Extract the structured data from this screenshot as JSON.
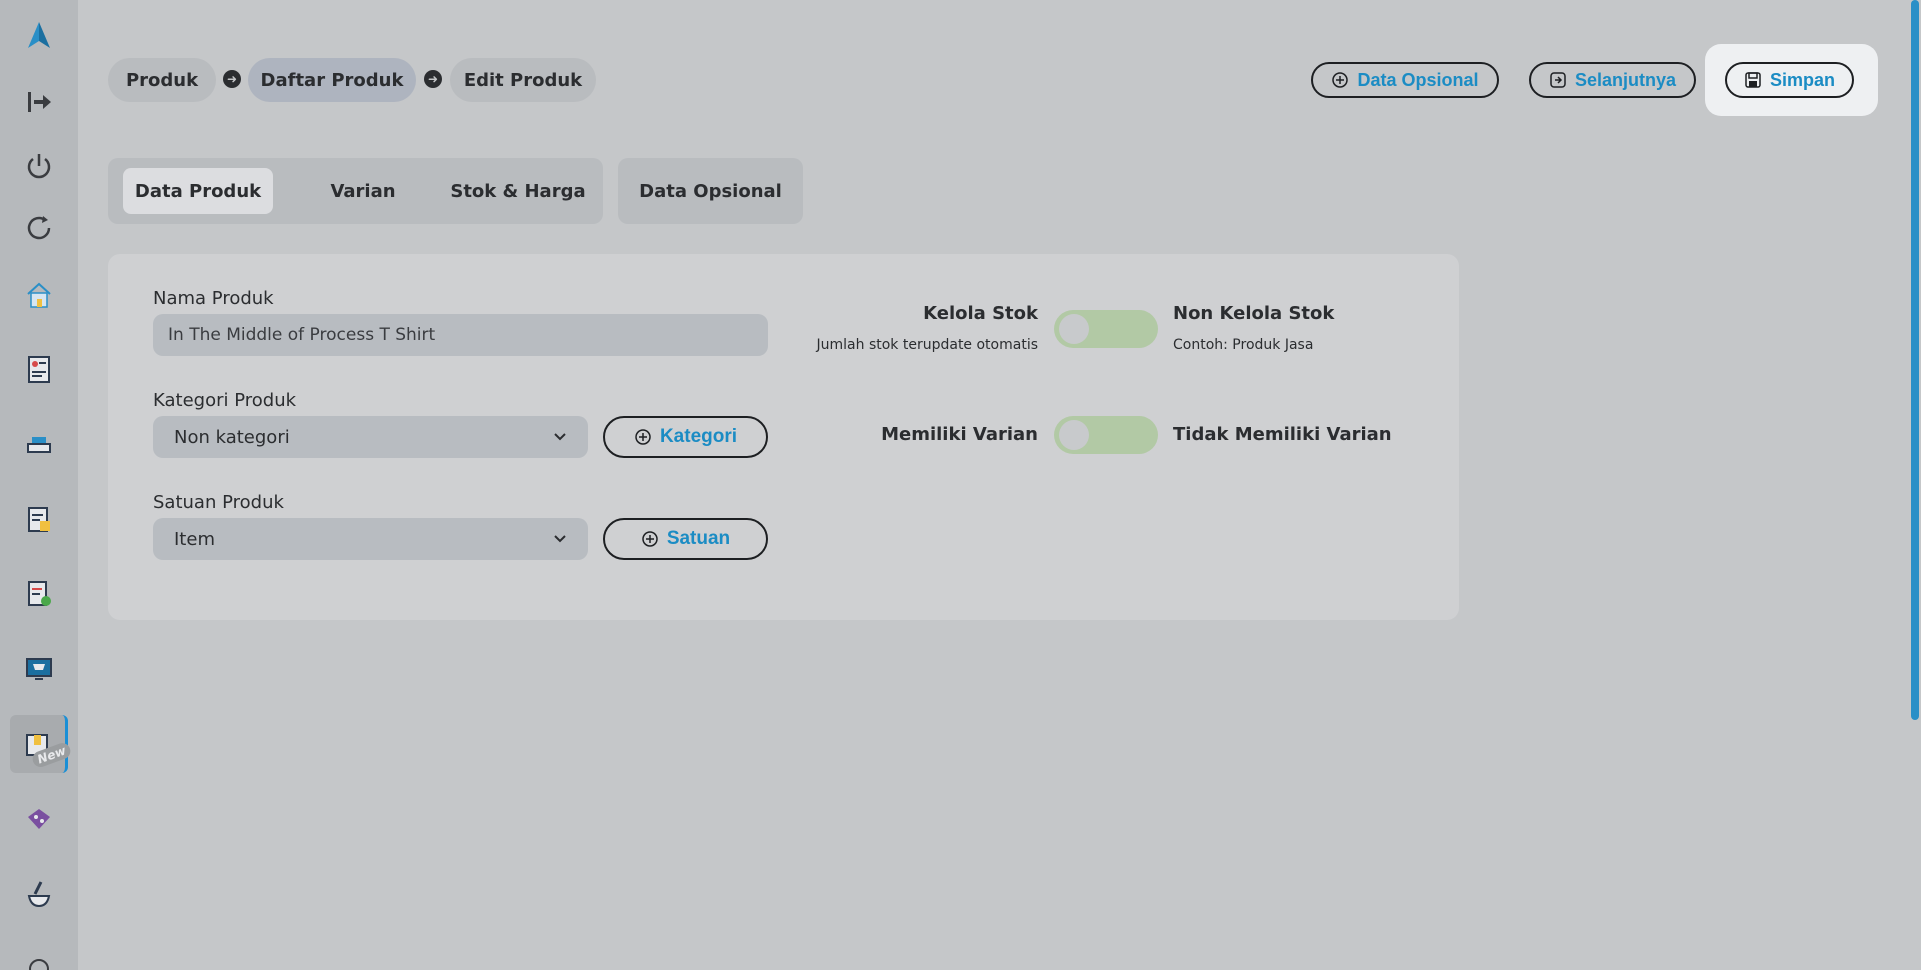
{
  "sidebar": {
    "items": [
      {
        "icon": "logo-icon"
      },
      {
        "icon": "logout-icon"
      },
      {
        "icon": "power-icon"
      },
      {
        "icon": "refresh-icon"
      },
      {
        "icon": "home-icon"
      },
      {
        "icon": "report-icon"
      },
      {
        "icon": "cashier-icon"
      },
      {
        "icon": "clipboard-icon"
      },
      {
        "icon": "invoice-icon"
      },
      {
        "icon": "monitor-cart-icon"
      },
      {
        "icon": "product-box-icon",
        "badge": "New",
        "active": true
      },
      {
        "icon": "discount-tag-icon"
      },
      {
        "icon": "mortar-icon"
      }
    ]
  },
  "breadcrumb": {
    "items": [
      "Produk",
      "Daftar Produk",
      "Edit Produk"
    ]
  },
  "header": {
    "optional_label": "Data Opsional",
    "next_label": "Selanjutnya",
    "save_label": "Simpan"
  },
  "tabs": {
    "group1": [
      "Data Produk",
      "Varian",
      "Stok & Harga"
    ],
    "group2": [
      "Data Opsional"
    ],
    "active": "Data Produk"
  },
  "form": {
    "name_label": "Nama Produk",
    "name_value": "In The Middle of Process T Shirt",
    "category_label": "Kategori Produk",
    "category_value": "Non kategori",
    "category_button": "Kategori",
    "unit_label": "Satuan Produk",
    "unit_value": "Item",
    "unit_button": "Satuan"
  },
  "toggles": {
    "stock": {
      "left_label": "Kelola Stok",
      "left_sub": "Jumlah stok terupdate otomatis",
      "right_label": "Non Kelola Stok",
      "right_sub": "Contoh: Produk Jasa"
    },
    "variant": {
      "left_label": "Memiliki Varian",
      "right_label": "Tidak Memiliki Varian"
    }
  },
  "colors": {
    "accent": "#1b8cc4",
    "toggle_track": "#b2c9a5"
  }
}
